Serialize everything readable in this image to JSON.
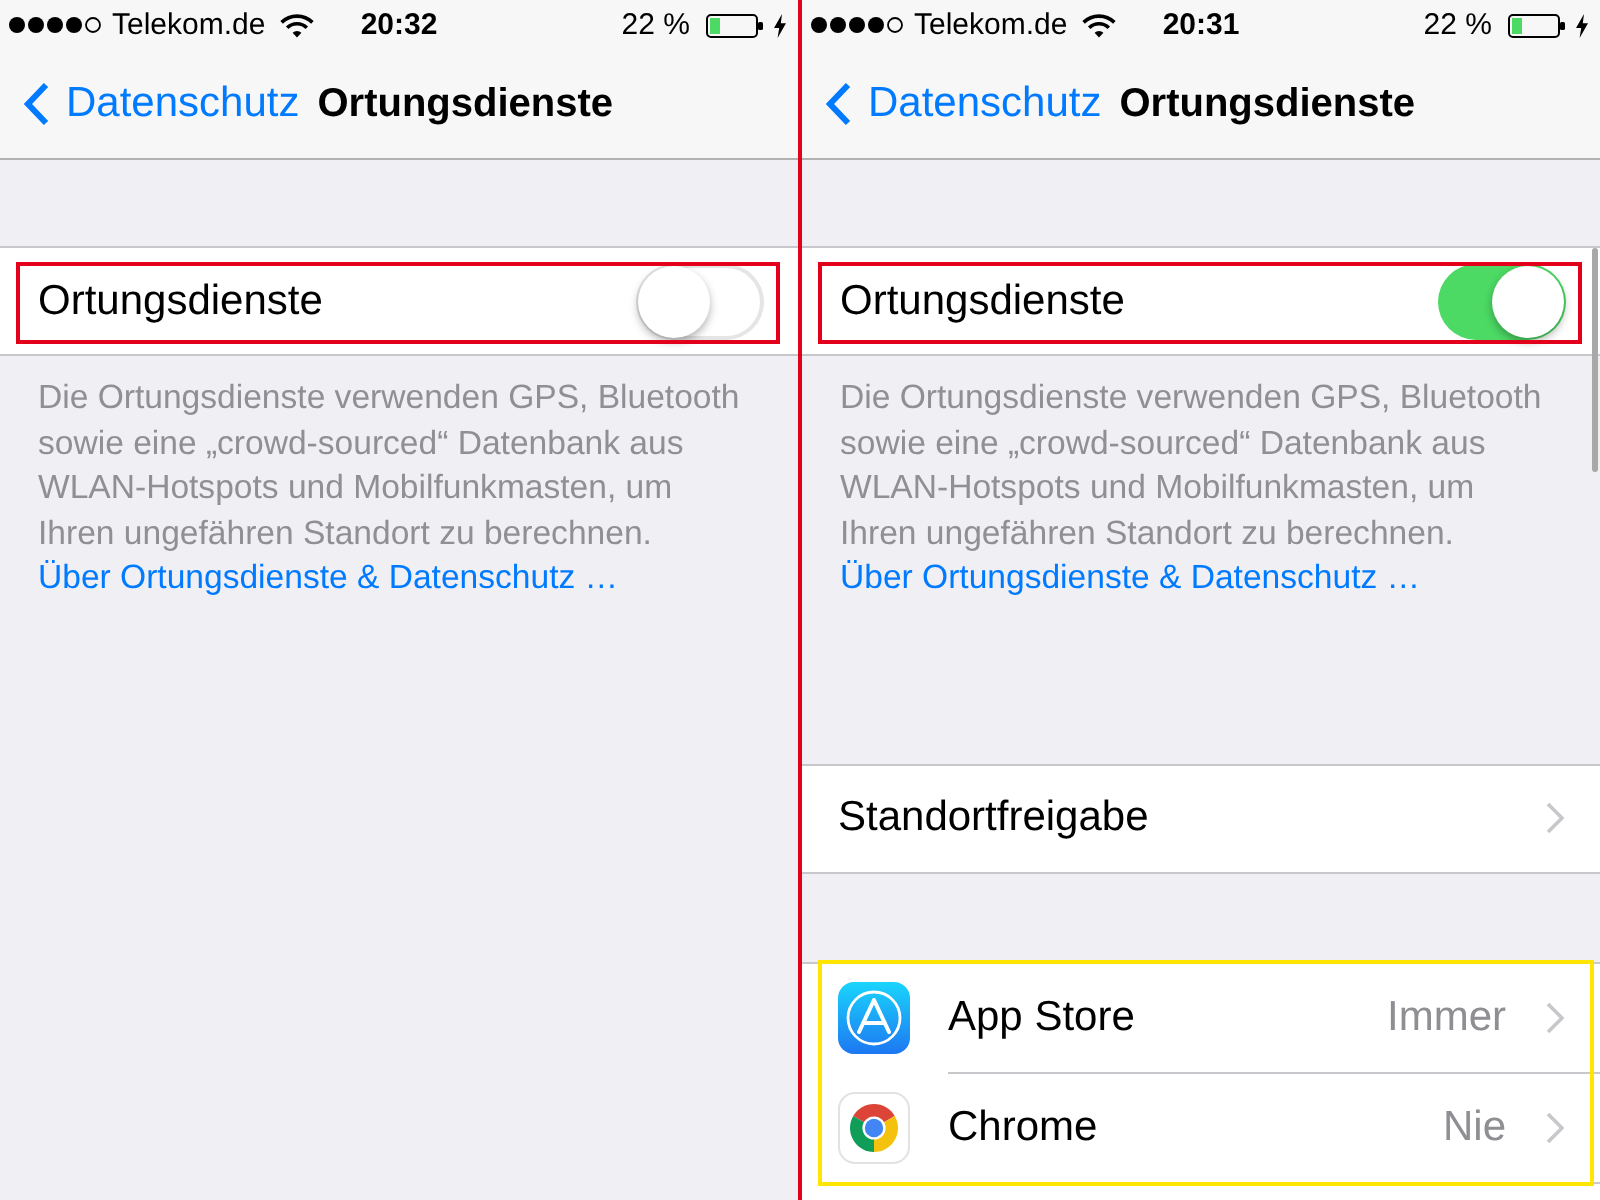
{
  "screens": [
    {
      "status_bar": {
        "carrier": "Telekom.de",
        "time": "20:32",
        "battery": "22 %"
      },
      "nav_bar": {
        "back": "Datenschutz",
        "title": "Ortungsdienste"
      },
      "location_toggle": {
        "label": "Ortungsdienste",
        "on": false,
        "highlight": {
          "color": "#e2001a"
        }
      },
      "footer": {
        "text": "Die Ortungsdienste verwenden GPS, Bluetooth sowie eine „crowd-sourced“ Datenbank aus WLAN-Hotspots und Mobilfunkmasten, um Ihren ungefähren Standort zu berechnen.",
        "link": "Über Ortungsdienste & Datenschutz …"
      }
    },
    {
      "status_bar": {
        "carrier": "Telekom.de",
        "time": "20:31",
        "battery": "22 %"
      },
      "nav_bar": {
        "back": "Datenschutz",
        "title": "Ortungsdienste"
      },
      "location_toggle": {
        "label": "Ortungsdienste",
        "on": true,
        "highlight": {
          "color": "#e2001a"
        }
      },
      "footer": {
        "text": "Die Ortungsdienste verwenden GPS, Bluetooth sowie eine „crowd-sourced“ Datenbank aus WLAN-Hotspots und Mobilfunkmasten, um Ihren ungefähren Standort zu berechnen.",
        "link": "Über Ortungsdienste & Datenschutz …"
      },
      "sections": [
        {
          "rows": [
            {
              "kind": "link",
              "label": "Standortfreigabe"
            }
          ]
        },
        {
          "highlight": {
            "color": "#ffe500"
          },
          "rows": [
            {
              "kind": "app",
              "label": "App Store",
              "value": "Immer"
            },
            {
              "kind": "app",
              "label": "Chrome",
              "value": "Nie"
            }
          ]
        }
      ]
    }
  ]
}
